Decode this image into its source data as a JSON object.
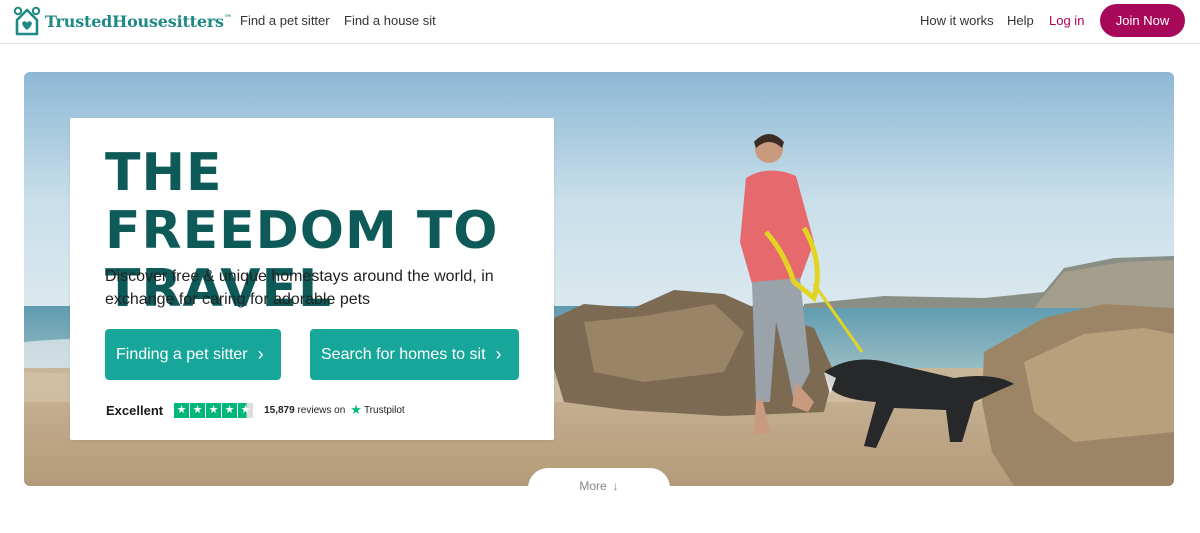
{
  "brand": {
    "name": "TrustedHousesitters",
    "trademark": "™",
    "color": "#1f8a85",
    "logo_icon": "house-heart-logo-icon"
  },
  "nav": {
    "left_links": [
      "Find a pet sitter",
      "Find a house sit"
    ],
    "right_links": [
      "How it works",
      "Help"
    ],
    "login": "Log in",
    "join": "Join Now"
  },
  "hero": {
    "headline": "THE FREEDOM TO TRAVEL",
    "subtext": "Discover free & unique homestays around the world, in exchange for caring for adorable pets",
    "cta_primary": "Finding a pet sitter",
    "cta_secondary": "Search for homes to sit",
    "cta_icon": "chevron-right-icon",
    "image": "woman-walking-dog-on-beach"
  },
  "trustpilot": {
    "rating_label": "Excellent",
    "stars": 4.5,
    "review_count": "15,879",
    "reviews_on": "reviews on",
    "brand": "Trustpilot"
  },
  "more": {
    "label": "More",
    "icon": "arrow-down-icon"
  },
  "colors": {
    "teal_dark": "#0e5a59",
    "teal_button": "#17a79a",
    "magenta": "#a8085a",
    "trustpilot_green": "#00b67a"
  }
}
